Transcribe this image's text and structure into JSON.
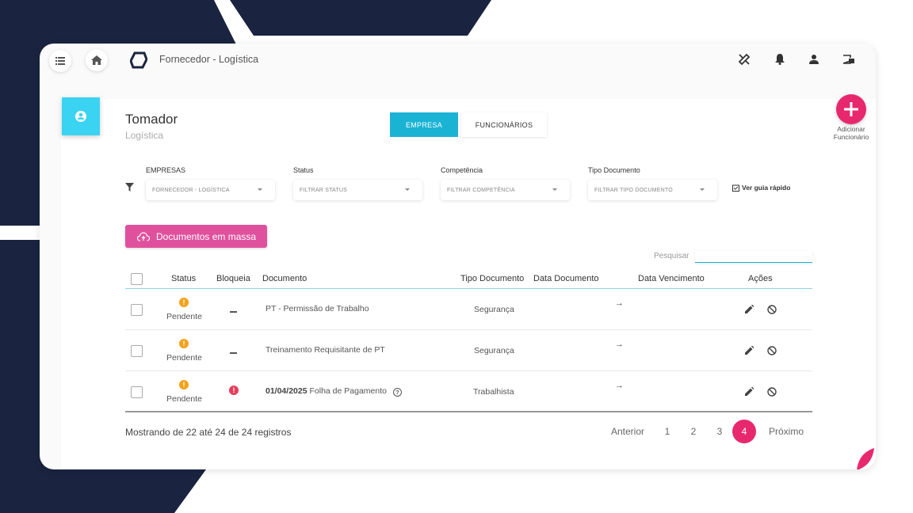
{
  "header": {
    "app_title": "Fornecedor - Logística"
  },
  "profile": {
    "title": "Tomador",
    "subtitle": "Logística"
  },
  "tabs": [
    {
      "label": "EMPRESA",
      "active": true
    },
    {
      "label": "FUNCIONÁRIOS",
      "active": false
    }
  ],
  "add_button": {
    "label_line1": "Adicionar",
    "label_line2": "Funcionário"
  },
  "filters": {
    "empresas": {
      "label": "EMPRESAS",
      "value": "FORNECEDOR - LOGÍSTICA"
    },
    "status": {
      "label": "Status",
      "value": "FILTRAR STATUS"
    },
    "competencia": {
      "label": "Competência",
      "value": "FILTRAR COMPETÊNCIA"
    },
    "tipo_documento": {
      "label": "Tipo Documento",
      "value": "FILTRAR TIPO DOCUMENTO"
    },
    "guia_label": "Ver guia rápido"
  },
  "mass_button": {
    "label": "Documentos em massa"
  },
  "search": {
    "label": "Pesquisar",
    "value": ""
  },
  "table": {
    "headers": {
      "status": "Status",
      "bloqueia": "Bloqueia",
      "documento": "Documento",
      "tipo_documento": "Tipo Documento",
      "data_documento": "Data Documento",
      "data_vencimento": "Data Vencimento",
      "acoes": "Ações"
    },
    "rows": [
      {
        "status": "Pendente",
        "status_icon": "!",
        "documento_date": "",
        "documento": "PT - Permissão de Trabalho",
        "tipo": "Segurança",
        "arrow": "→"
      },
      {
        "status": "Pendente",
        "status_icon": "!",
        "documento_date": "",
        "documento": "Treinamento Requisitante de PT",
        "tipo": "Segurança",
        "arrow": "→"
      },
      {
        "status": "Pendente",
        "status_icon": "!",
        "bloqueia_icon": "!",
        "documento_date": "01/04/2025",
        "documento": "Folha de Pagamento",
        "help_icon": "?",
        "tipo": "Trabalhista",
        "arrow": "→"
      }
    ]
  },
  "footer": {
    "info": "Mostrando de 22 até 24 de 24 registros",
    "prev": "Anterior",
    "pages": [
      "1",
      "2",
      "3",
      "4"
    ],
    "active_page": "4",
    "next": "Próximo"
  },
  "colors": {
    "navy": "#1a2440",
    "accent_cyan": "#1ab3d3",
    "avatar_cyan": "#3ad3f2",
    "pink": "#e8286e",
    "mass_pink": "#e0519d",
    "warning": "#f3a21b",
    "danger": "#e53d59"
  },
  "icons": {
    "menu": "menu-icon",
    "home": "home-icon",
    "logo": "logo-icon",
    "tools": "tools-icon",
    "bell": "bell-icon",
    "user": "user-icon",
    "logout": "logout-icon",
    "avatar": "account-circle-icon",
    "filter": "filter-icon",
    "upload": "cloud-upload-icon",
    "edit": "pencil-icon",
    "block": "block-icon"
  }
}
